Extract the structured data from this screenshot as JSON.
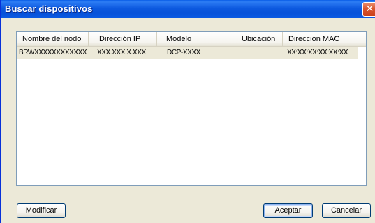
{
  "window": {
    "title": "Buscar dispositivos",
    "close_glyph": "✕"
  },
  "list": {
    "columns": [
      "Nombre del nodo",
      "Dirección IP",
      "Modelo",
      "Ubicación",
      "Dirección MAC"
    ],
    "rows": [
      {
        "node_name": "BRWXXXXXXXXXXXX",
        "ip": "XXX.XXX.X.XXX",
        "model": "DCP-XXXX",
        "location": "",
        "mac": "XX:XX:XX:XX:XX:XX"
      }
    ]
  },
  "buttons": {
    "modify": "Modificar",
    "accept": "Aceptar",
    "cancel": "Cancelar"
  },
  "colors": {
    "titlebar": "#0a59e2",
    "window_bg": "#ece9d8",
    "close_button": "#d9552e",
    "selected_row": "#ece9d8"
  }
}
